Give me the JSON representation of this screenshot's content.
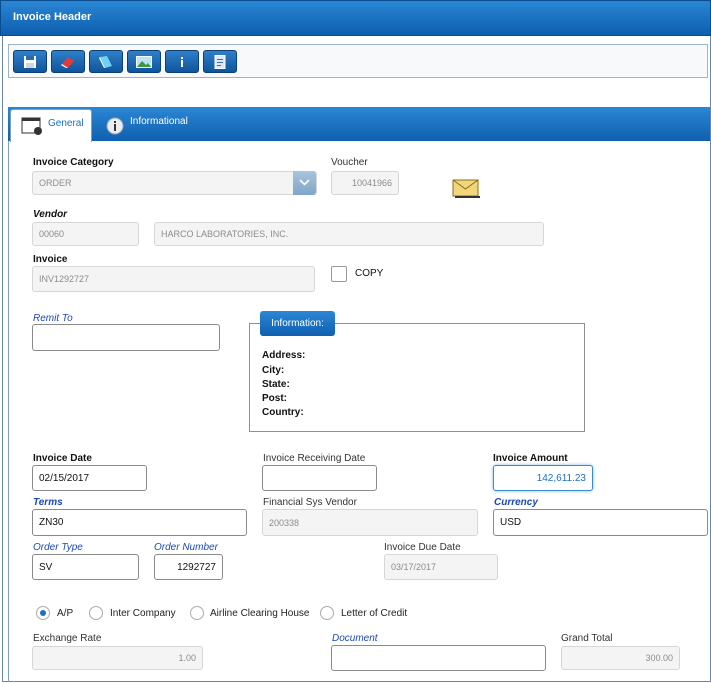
{
  "window": {
    "title": "Invoice Header"
  },
  "toolbar": {
    "buttons": [
      {
        "name": "save-icon"
      },
      {
        "name": "eraser-icon"
      },
      {
        "name": "book-icon"
      },
      {
        "name": "image-icon"
      },
      {
        "name": "info-icon"
      },
      {
        "name": "document-icon"
      }
    ]
  },
  "tabs": [
    {
      "label": "General",
      "active": true
    },
    {
      "label": "Informational",
      "active": false
    }
  ],
  "form": {
    "invoice_category": {
      "label": "Invoice Category",
      "value": "ORDER"
    },
    "voucher": {
      "label": "Voucher",
      "value": "10041966"
    },
    "vendor": {
      "label": "Vendor",
      "code": "00060",
      "name": "HARCO LABORATORIES, INC."
    },
    "invoice": {
      "label": "Invoice",
      "value": "INV1292727"
    },
    "copy": {
      "label": "COPY",
      "checked": false
    },
    "remit_to": {
      "label": "Remit To",
      "value": ""
    },
    "information": {
      "title": "Information:",
      "address": "Address:",
      "city": "City:",
      "state": "State:",
      "post": "Post:",
      "country": "Country:"
    },
    "invoice_date": {
      "label": "Invoice Date",
      "value": "02/15/2017"
    },
    "invoice_receiving_date": {
      "label": "Invoice Receiving Date",
      "value": ""
    },
    "invoice_amount": {
      "label": "Invoice Amount",
      "value": "142,611.23"
    },
    "terms": {
      "label": "Terms",
      "value": "ZN30"
    },
    "financial_sys_vendor": {
      "label": "Financial Sys Vendor",
      "value": "200338"
    },
    "currency": {
      "label": "Currency",
      "value": "USD"
    },
    "order_type": {
      "label": "Order Type",
      "value": "SV"
    },
    "order_number": {
      "label": "Order Number",
      "value": "1292727"
    },
    "invoice_due_date": {
      "label": "Invoice Due Date",
      "value": "03/17/2017"
    },
    "payment_type": {
      "options": [
        "A/P",
        "Inter Company",
        "Airline Clearing House",
        "Letter of Credit"
      ],
      "selected": "A/P"
    },
    "exchange_rate": {
      "label": "Exchange Rate",
      "value": "1.00"
    },
    "document": {
      "label": "Document",
      "value": ""
    },
    "grand_total": {
      "label": "Grand Total",
      "value": "300.00"
    }
  },
  "colors": {
    "accent": "#1665b5",
    "link_label": "#1b47b9"
  }
}
